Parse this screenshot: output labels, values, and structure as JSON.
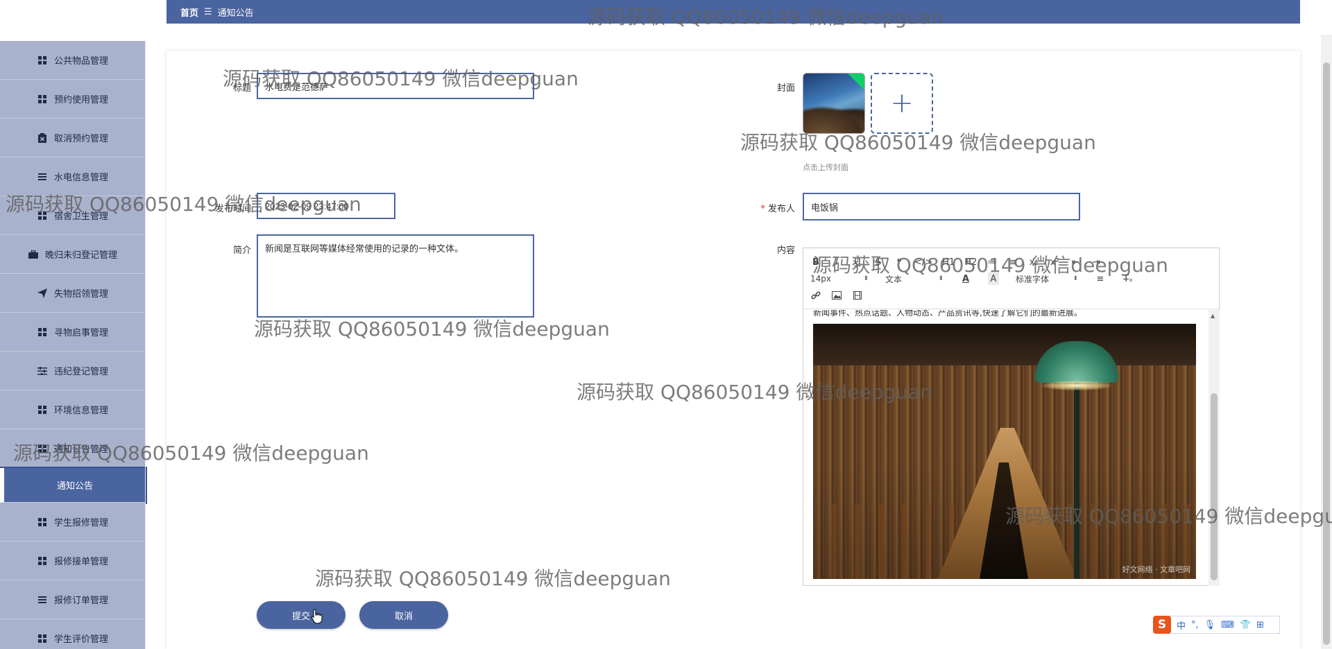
{
  "breadcrumb": {
    "home": "首页",
    "separator": "☰",
    "current": "通知公告"
  },
  "sidebar": {
    "items": [
      {
        "label": "公共物品管理",
        "icon": "grid-icon"
      },
      {
        "label": "预约使用管理",
        "icon": "grid-icon"
      },
      {
        "label": "取消预约管理",
        "icon": "clipboard-x-icon"
      },
      {
        "label": "水电信息管理",
        "icon": "list-icon"
      },
      {
        "label": "宿舍卫生管理",
        "icon": "grid-icon"
      },
      {
        "label": "晚归未归登记管理",
        "icon": "briefcase-icon"
      },
      {
        "label": "失物招领管理",
        "icon": "paper-plane-icon"
      },
      {
        "label": "寻物启事管理",
        "icon": "grid-icon"
      },
      {
        "label": "违纪登记管理",
        "icon": "sliders-icon"
      },
      {
        "label": "环境信息管理",
        "icon": "grid-icon"
      },
      {
        "label": "通知公告管理",
        "icon": "grid-icon"
      }
    ],
    "active_sub": "通知公告",
    "items_after": [
      {
        "label": "学生报修管理",
        "icon": "grid-icon"
      },
      {
        "label": "报修接单管理",
        "icon": "grid-icon"
      },
      {
        "label": "报修订单管理",
        "icon": "list-icon"
      },
      {
        "label": "学生评价管理",
        "icon": "grid-icon"
      }
    ]
  },
  "form": {
    "title_label": "标题",
    "title_value": "水电费是范德萨",
    "cover_label": "封面",
    "cover_hint": "点击上传封面",
    "publish_time_label": "发布时间",
    "publish_time_value": "2023-02-09 23:47:00",
    "publisher_label": "发布人",
    "publisher_value": "电饭锅",
    "intro_label": "简介",
    "intro_value": "新闻是互联网等媒体经常使用的记录的一种文体。",
    "content_label": "内容",
    "submit_label": "提交",
    "cancel_label": "取消"
  },
  "editor": {
    "toolbar_row1": [
      "B",
      "I",
      "U",
      "S",
      "❝",
      "</>",
      "H1",
      "H2",
      "≔",
      "≡",
      "x₂",
      "x²",
      "⇤",
      "⇥"
    ],
    "font_size": "14px",
    "text_type": "文本",
    "font_family": "标准字体",
    "content_text": "新闻事件、热点话题、人物动态、产品资讯等,快速了解它们的最新进展。",
    "image_watermark": "好文网络 · 文章吧网"
  },
  "watermark_text": "源码获取 QQ86050149 微信deepguan",
  "ime": {
    "logo": "S",
    "lang": "中",
    "punct": "°,",
    "items": [
      "mic-icon",
      "keyboard-icon",
      "shirt-icon",
      "apps-icon"
    ]
  },
  "colors": {
    "primary": "#4a64a0",
    "sidebar_bg": "#a9b2cc",
    "required": "#e03030"
  }
}
